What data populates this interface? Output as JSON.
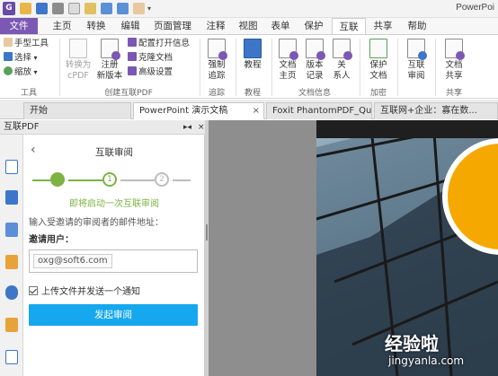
{
  "app": {
    "logo": "G",
    "title": "PowerPoi"
  },
  "quick_access": [
    "open-icon",
    "save-icon",
    "print-icon",
    "new-icon",
    "copy-icon",
    "undo-icon",
    "redo-icon",
    "hand-icon",
    "dropdown-icon"
  ],
  "menu": {
    "tabs": [
      {
        "label": "文件"
      },
      {
        "label": "主页"
      },
      {
        "label": "转换"
      },
      {
        "label": "编辑"
      },
      {
        "label": "页面管理"
      },
      {
        "label": "注释"
      },
      {
        "label": "视图"
      },
      {
        "label": "表单"
      },
      {
        "label": "保护"
      },
      {
        "label": "互联"
      },
      {
        "label": "共享"
      },
      {
        "label": "帮助"
      }
    ],
    "active": "互联"
  },
  "ribbon": {
    "tools": {
      "hand": "手型工具",
      "select": "选择",
      "zoom": "缩放",
      "group": "工具"
    },
    "create": {
      "convert_line1": "转换为",
      "convert_line2": "cPDF",
      "register_line1": "注册",
      "register_line2": "新版本",
      "config": "配置打开信息",
      "clone": "克隆文档",
      "advanced": "高级设置",
      "group": "创建互联PDF"
    },
    "track": {
      "line1": "强制",
      "line2": "追踪",
      "group": "追踪"
    },
    "tutorial": {
      "label": "教程",
      "group": "教程"
    },
    "docinfo": {
      "home_line1": "文档",
      "home_line2": "主页",
      "version_line1": "版本",
      "version_line2": "记录",
      "contacts_line1": "关",
      "contacts_line2": "系人",
      "group": "文档信息"
    },
    "encrypt": {
      "line1": "保护",
      "line2": "文档",
      "group": "加密"
    },
    "review": {
      "line1": "互联",
      "line2": "审阅",
      "line3": ""
    },
    "share": {
      "line1": "文档",
      "line2": "共享",
      "group": "共享"
    }
  },
  "doc_tabs": [
    {
      "label": "开始"
    },
    {
      "label": "PowerPoint 演示文稿"
    },
    {
      "label": "Foxit PhantomPDF_Qui..."
    },
    {
      "label": "互联网+企业：寡在数..."
    }
  ],
  "panel": {
    "header": "互联PDF",
    "title": "互联审阅",
    "steps": [
      "",
      "1",
      "2"
    ],
    "caption": "即将启动一次互联审阅",
    "hint": "输入受邀请的审阅者的邮件地址：",
    "invite_label": "邀请用户：",
    "email": "oxg@soft6.com",
    "notify": "上传文件并发送一个通知",
    "notify_checked": true,
    "submit": "发起审阅"
  },
  "sidebar_icons": [
    "page-icon",
    "layers-icon",
    "stack-icon",
    "comment-icon",
    "attachment-icon",
    "lock-icon",
    "document-icon"
  ],
  "watermark": {
    "cn": "经验啦",
    "url": "jingyanla.com"
  },
  "colors": {
    "brand": "#7b58b3",
    "accent_green": "#7cb342",
    "button_blue": "#16a8ee"
  }
}
